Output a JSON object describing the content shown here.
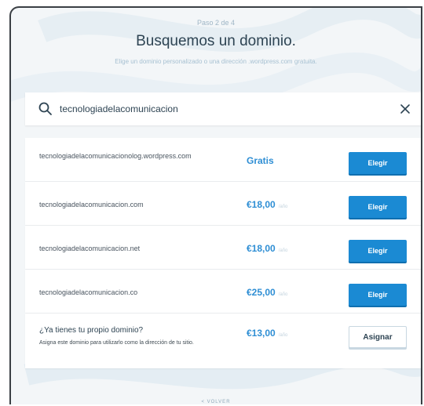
{
  "header": {
    "step": "Paso 2 de 4",
    "title": "Busquemos un dominio.",
    "subtitle": "Elige un dominio personalizado o una dirección .wordpress.com gratuita."
  },
  "search": {
    "value": "tecnologiadelacomunicacion",
    "icon": "search-icon",
    "clear_icon": "close-icon"
  },
  "results": [
    {
      "domain": "tecnologiadelacomunicacionolog.wordpress.com",
      "price": "Gratis",
      "per": "",
      "action": "Elegir"
    },
    {
      "domain": "tecnologiadelacomunicacion.com",
      "price": "€18,00",
      "per": "/año",
      "action": "Elegir"
    },
    {
      "domain": "tecnologiadelacomunicacion.net",
      "price": "€18,00",
      "per": "/año",
      "action": "Elegir"
    },
    {
      "domain": "tecnologiadelacomunicacion.co",
      "price": "€25,00",
      "per": "/año",
      "action": "Elegir"
    }
  ],
  "own_domain": {
    "question": "¿Ya tienes tu propio dominio?",
    "description": "Asigna este dominio para utilizarlo como la dirección de tu sitio.",
    "price": "€13,00",
    "per": "/año",
    "action": "Asignar"
  },
  "footer": {
    "back": "< VOLVER"
  },
  "colors": {
    "accent": "#1b8ad3",
    "price": "#2e8ed4",
    "title": "#2e4453"
  }
}
